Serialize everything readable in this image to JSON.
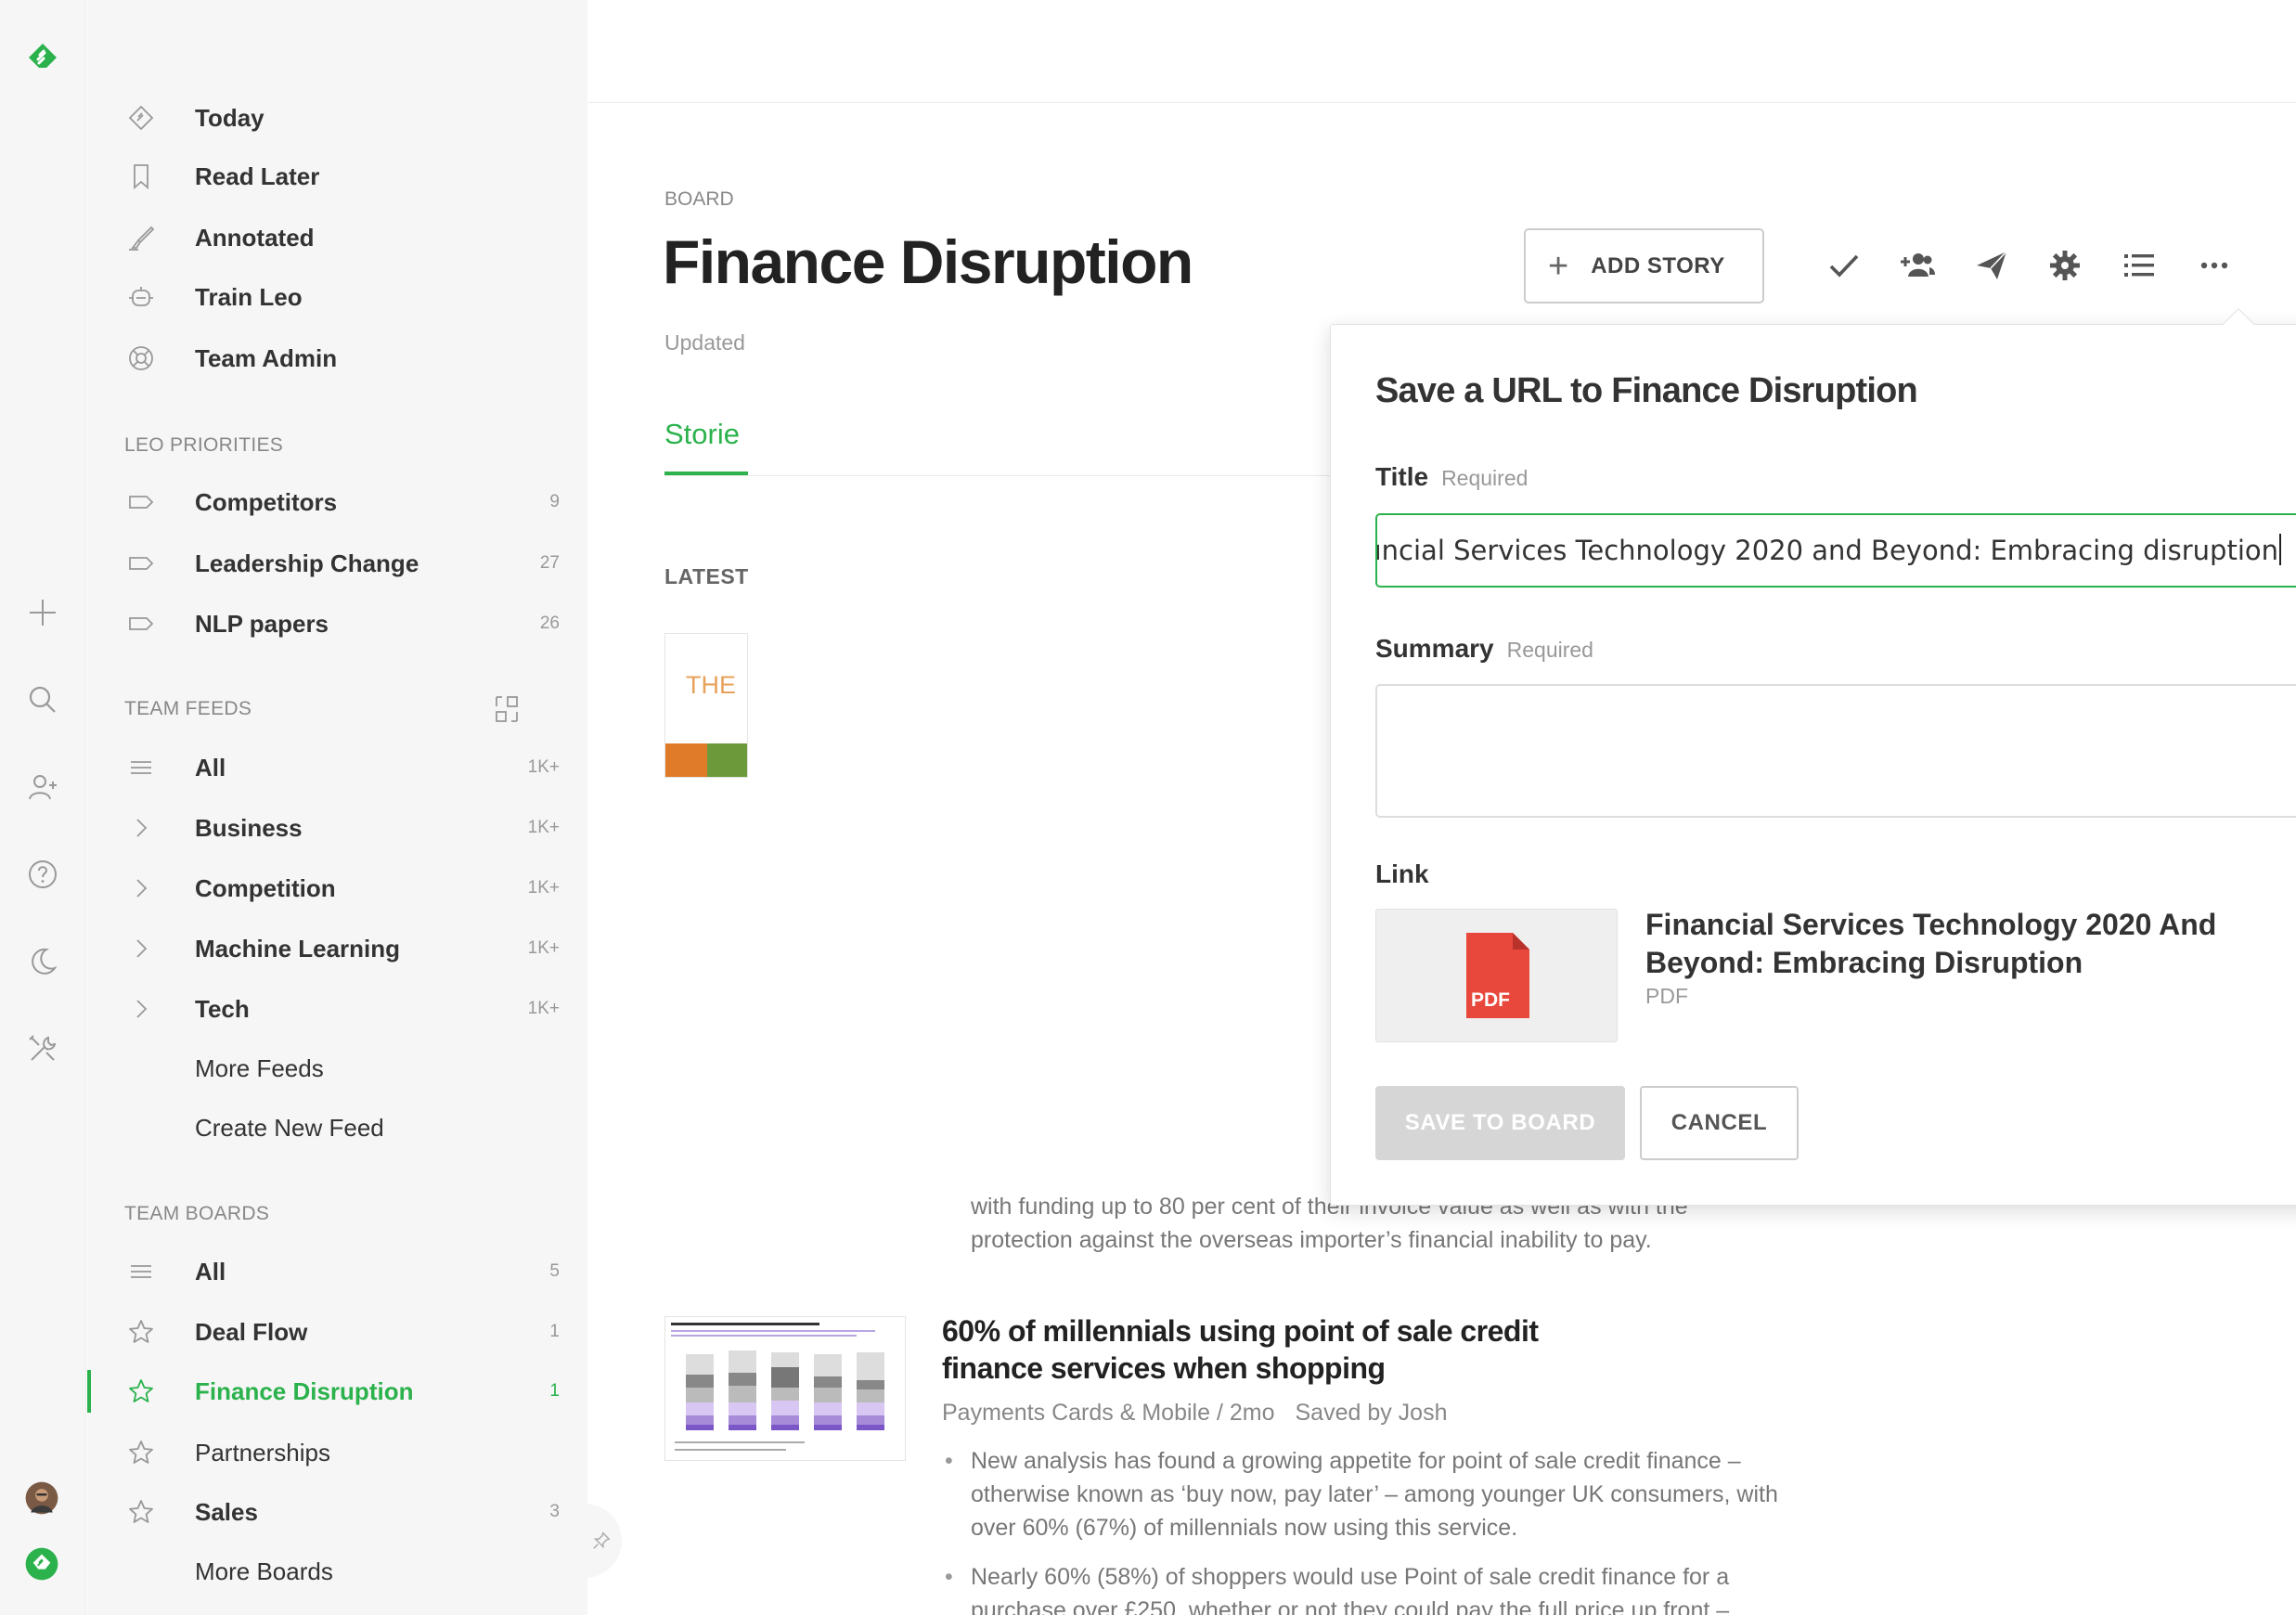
{
  "sidebar": {
    "primary": [
      {
        "label": "Today",
        "icon": "today-icon"
      },
      {
        "label": "Read Later",
        "icon": "bookmark-icon"
      },
      {
        "label": "Annotated",
        "icon": "highlighter-icon"
      },
      {
        "label": "Train Leo",
        "icon": "leo-icon"
      },
      {
        "label": "Team Admin",
        "icon": "lifebuoy-icon"
      }
    ],
    "leo_priorities": {
      "title": "LEO PRIORITIES",
      "items": [
        {
          "label": "Competitors",
          "count": "9"
        },
        {
          "label": "Leadership Change",
          "count": "27"
        },
        {
          "label": "NLP papers",
          "count": "26"
        }
      ]
    },
    "team_feeds": {
      "title": "TEAM FEEDS",
      "items": [
        {
          "label": "All",
          "count": "1K+"
        },
        {
          "label": "Business",
          "count": "1K+"
        },
        {
          "label": "Competition",
          "count": "1K+"
        },
        {
          "label": "Machine Learning",
          "count": "1K+"
        },
        {
          "label": "Tech",
          "count": "1K+"
        }
      ],
      "more": "More Feeds",
      "create": "Create New Feed"
    },
    "team_boards": {
      "title": "TEAM BOARDS",
      "items": [
        {
          "label": "All",
          "count": "5"
        },
        {
          "label": "Deal Flow",
          "count": "1"
        },
        {
          "label": "Finance Disruption",
          "count": "1"
        },
        {
          "label": "Partnerships",
          "count": ""
        },
        {
          "label": "Sales",
          "count": "3"
        }
      ],
      "more": "More Boards"
    }
  },
  "board": {
    "eyebrow": "BOARD",
    "title": "Finance Disruption",
    "updated": "Updated",
    "tab": "Storie",
    "latest": "LATEST",
    "add_story": "ADD STORY"
  },
  "article1": {
    "thumb_text": "THE",
    "snippet_line1": "with funding up to 80 per cent of their invoice value as well as with the",
    "snippet_line2": "protection against the overseas importer’s financial inability to pay."
  },
  "article2": {
    "title": "60% of millennials using point of sale credit finance services when shopping",
    "source": "Payments Cards & Mobile / 2mo",
    "saved_by": "Saved by Josh",
    "bullet1": "New analysis has found a growing appetite for point of sale credit finance – otherwise known as ‘buy now, pay later’ – among younger UK consumers, with over 60% (67%) of millennials now using this service.",
    "bullet2": "Nearly 60% (58%) of shoppers would use Point of sale credit finance for a purchase over £250, whether or not they could pay the full price up front –"
  },
  "popover": {
    "title": "Save a URL to Finance Disruption",
    "title_label": "Title",
    "summary_label": "Summary",
    "required": "Required",
    "title_value": "ıncial Services Technology 2020 and Beyond: Embracing disruption",
    "link_label": "Link",
    "link_title": "Financial Services Technology 2020 And Beyond: Embracing Disruption",
    "link_type": "PDF",
    "pdf_badge": "PDF",
    "save_button": "SAVE TO BOARD",
    "cancel_button": "CANCEL"
  },
  "colors": {
    "accent": "#2bb24c",
    "pdf": "#e8473b"
  }
}
